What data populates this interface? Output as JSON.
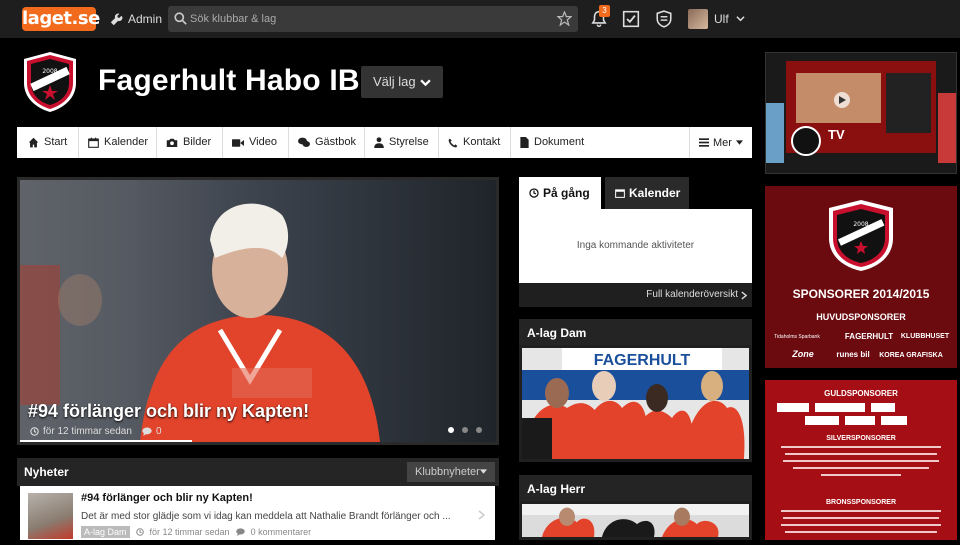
{
  "topbar": {
    "logo": "laget.se",
    "admin_label": "Admin",
    "search_placeholder": "Sök klubbar & lag",
    "notification_count": "3",
    "user_name": "Ulf"
  },
  "club": {
    "title": "Fagerhult Habo IB",
    "team_select": "Välj lag"
  },
  "nav": {
    "items": [
      "Start",
      "Kalender",
      "Bilder",
      "Video",
      "Gästbok",
      "Styrelse",
      "Kontakt",
      "Dokument"
    ],
    "more": "Mer"
  },
  "hero": {
    "title": "#94 förlänger och blir ny Kapten!",
    "time": "för 12 timmar sedan",
    "comments": "0",
    "slide_count": 3,
    "active_slide": 1
  },
  "news": {
    "heading": "Nyheter",
    "filter": "Klubbnyheter",
    "item": {
      "title": "#94 förlänger och blir ny Kapten!",
      "excerpt": "Det är med stor glädje som vi idag kan meddela att Nathalie Brandt förlänger och ...",
      "tag": "A-lag Dam",
      "time": "för 12 timmar sedan",
      "comments": "0 kommentarer"
    }
  },
  "calendar": {
    "tab_active": "På gång",
    "tab_inactive": "Kalender",
    "empty": "Inga kommande aktiviteter",
    "footer_link": "Full kalenderöversikt"
  },
  "teams": {
    "dam": "A-lag Dam",
    "herr": "A-lag Herr",
    "photo_banner": "FAGERHULT"
  },
  "sidebar": {
    "tv_label": "TV",
    "crest_year": "2008",
    "sponsor_heading": "SPONSORER 2014/2015",
    "huvud_heading": "HUVUDSPONSORER",
    "huvud_sponsors": [
      "Tidaholms Sparbank",
      "FAGERHULT",
      "KLUBBHUSET",
      "Zone",
      "runes bil",
      "KOREA GRAFISKA"
    ],
    "guld_heading": "GULDSPONSORER",
    "silver_heading": "SILVERSPONSORER",
    "brons_heading": "BRONSSPONSORER"
  },
  "colors": {
    "brand_orange": "#f26b1d",
    "club_red": "#c8102e",
    "page_bg": "#000000"
  }
}
